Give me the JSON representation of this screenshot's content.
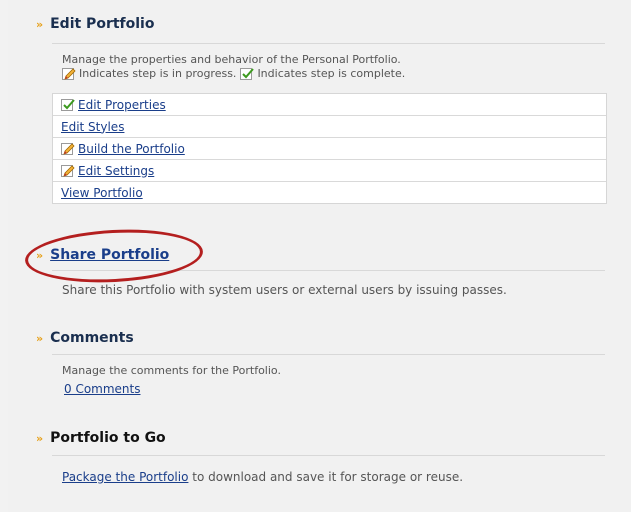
{
  "edit_portfolio": {
    "title": "Edit Portfolio",
    "description": "Manage the properties and behavior of the Personal Portfolio.",
    "legend_progress": "Indicates step is in progress.",
    "legend_complete": "Indicates step is complete.",
    "steps": [
      {
        "label": "Edit Properties",
        "status": "complete"
      },
      {
        "label": "Edit Styles",
        "status": "none"
      },
      {
        "label": "Build the Portfolio",
        "status": "in-progress"
      },
      {
        "label": "Edit Settings",
        "status": "in-progress"
      },
      {
        "label": "View Portfolio",
        "status": "none"
      }
    ]
  },
  "share_portfolio": {
    "title": "Share Portfolio",
    "description": "Share this Portfolio with system users or external users by issuing passes."
  },
  "comments": {
    "title": "Comments",
    "description": "Manage the comments for the Portfolio.",
    "count_link": "0 Comments"
  },
  "portfolio_to_go": {
    "title": "Portfolio to Go",
    "link": "Package the Portfolio",
    "description_suffix": " to download and save it for storage or reuse."
  },
  "colors": {
    "accent": "#e6a019",
    "link": "#1a3e8a",
    "highlight_circle": "#b41f1f"
  }
}
